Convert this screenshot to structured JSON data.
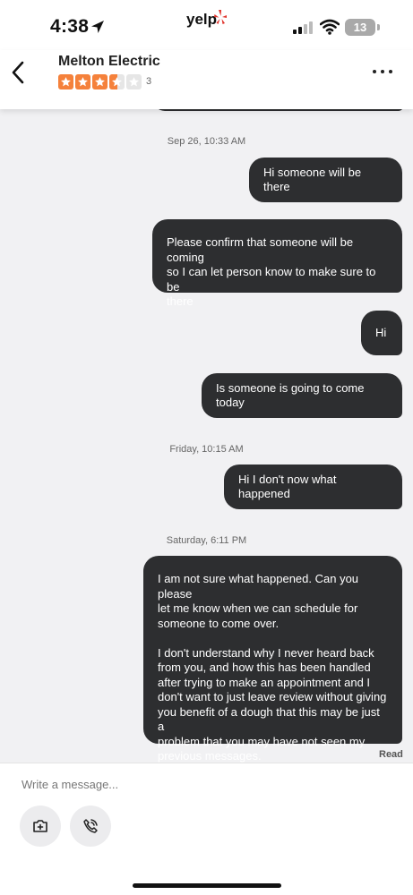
{
  "status_bar": {
    "time": "4:38",
    "carrier_logo": "yelp",
    "battery": "13",
    "icons": [
      "location-arrow-icon",
      "yelp-burst-icon",
      "signal-icon",
      "wifi-icon",
      "battery-icon"
    ]
  },
  "header": {
    "business_name": "Melton Electric",
    "rating": 3.5,
    "rating_max": 5,
    "review_count": "3",
    "accent_color": "#f5813b",
    "icons": [
      "back-chevron-icon",
      "more-dots-icon"
    ]
  },
  "messages": [
    {
      "kind": "timestamp",
      "text": "Sep 26, 10:33 AM"
    },
    {
      "kind": "sent",
      "text": "Hi someone will be there"
    },
    {
      "kind": "sent",
      "text": "Please confirm that someone will be coming\nso I can let person know to make sure to be\nthere"
    },
    {
      "kind": "sent",
      "text": "Hi"
    },
    {
      "kind": "sent",
      "text": "Is someone is going to come today"
    },
    {
      "kind": "timestamp",
      "text": "Friday, 10:15 AM"
    },
    {
      "kind": "sent",
      "text": "Hi I don't now what happened"
    },
    {
      "kind": "timestamp",
      "text": "Saturday, 6:11 PM"
    },
    {
      "kind": "sent",
      "text": "I am not sure what happened. Can you please\nlet me know when we can schedule for\nsomeone to come over.\n\nI don't understand why I never heard back\nfrom you, and  how this has been handled\nafter trying to make an appointment and I\ndon't want to just leave review without giving\nyou benefit of a dough that this may be just a\nproblem that you may have not seen my\nprevious messages."
    }
  ],
  "read_receipt": "Read",
  "bubble_color": "#2d2e30",
  "composer": {
    "placeholder": "Write a message...",
    "value": "",
    "buttons": [
      "camera-plus-icon",
      "phone-call-icon"
    ]
  }
}
